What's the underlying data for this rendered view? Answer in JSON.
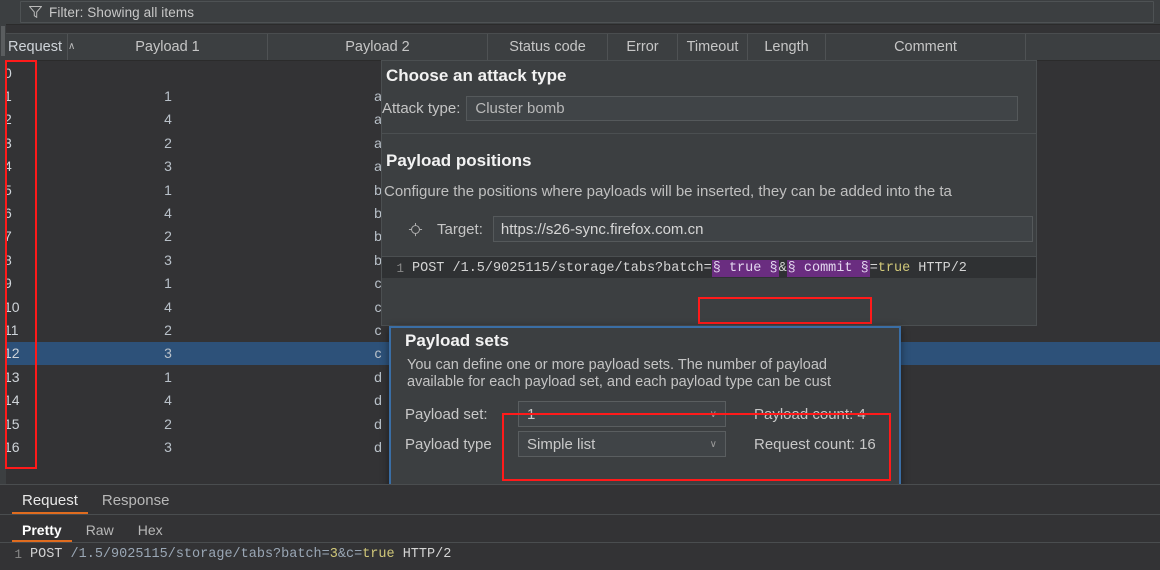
{
  "filter": {
    "icon": "funnel-icon",
    "text": "Filter: Showing all items"
  },
  "table": {
    "columns": [
      {
        "label": "Request",
        "sort": "∧"
      },
      {
        "label": "Payload 1"
      },
      {
        "label": "Payload 2"
      },
      {
        "label": "Status code"
      },
      {
        "label": "Error"
      },
      {
        "label": "Timeout"
      },
      {
        "label": "Length"
      },
      {
        "label": "Comment"
      }
    ],
    "rows": [
      {
        "request": "0",
        "p1": "",
        "p2": "",
        "status": "",
        "error": "",
        "timeout": "",
        "length": "",
        "comment": "",
        "selected": false
      },
      {
        "request": "1",
        "p1": "1",
        "p2": "a",
        "status": "",
        "error": "",
        "timeout": "",
        "length": "",
        "comment": "",
        "selected": false
      },
      {
        "request": "2",
        "p1": "4",
        "p2": "a",
        "status": "",
        "error": "",
        "timeout": "",
        "length": "",
        "comment": "",
        "selected": false
      },
      {
        "request": "3",
        "p1": "2",
        "p2": "a",
        "status": "",
        "error": "",
        "timeout": "",
        "length": "",
        "comment": "",
        "selected": false
      },
      {
        "request": "4",
        "p1": "3",
        "p2": "a",
        "status": "",
        "error": "",
        "timeout": "",
        "length": "",
        "comment": "",
        "selected": false
      },
      {
        "request": "5",
        "p1": "1",
        "p2": "b",
        "status": "",
        "error": "",
        "timeout": "",
        "length": "",
        "comment": "",
        "selected": false
      },
      {
        "request": "6",
        "p1": "4",
        "p2": "b",
        "status": "",
        "error": "",
        "timeout": "",
        "length": "",
        "comment": "",
        "selected": false
      },
      {
        "request": "7",
        "p1": "2",
        "p2": "b",
        "status": "",
        "error": "",
        "timeout": "",
        "length": "",
        "comment": "",
        "selected": false
      },
      {
        "request": "8",
        "p1": "3",
        "p2": "b",
        "status": "",
        "error": "",
        "timeout": "",
        "length": "",
        "comment": "",
        "selected": false
      },
      {
        "request": "9",
        "p1": "1",
        "p2": "c",
        "status": "",
        "error": "",
        "timeout": "",
        "length": "",
        "comment": "",
        "selected": false
      },
      {
        "request": "10",
        "p1": "4",
        "p2": "c",
        "status": "",
        "error": "",
        "timeout": "",
        "length": "",
        "comment": "",
        "selected": false
      },
      {
        "request": "11",
        "p1": "2",
        "p2": "c",
        "status": "",
        "error": "",
        "timeout": "",
        "length": "",
        "comment": "",
        "selected": false
      },
      {
        "request": "12",
        "p1": "3",
        "p2": "c",
        "status": "",
        "error": "",
        "timeout": "",
        "length": "",
        "comment": "",
        "selected": true
      },
      {
        "request": "13",
        "p1": "1",
        "p2": "d",
        "status": "",
        "error": "",
        "timeout": "",
        "length": "",
        "comment": "",
        "selected": false
      },
      {
        "request": "14",
        "p1": "4",
        "p2": "d",
        "status": "",
        "error": "",
        "timeout": "",
        "length": "",
        "comment": "",
        "selected": false
      },
      {
        "request": "15",
        "p1": "2",
        "p2": "d",
        "status": "",
        "error": "",
        "timeout": "",
        "length": "",
        "comment": "",
        "selected": false
      },
      {
        "request": "16",
        "p1": "3",
        "p2": "d",
        "status": "",
        "error": "",
        "timeout": "",
        "length": "",
        "comment": "",
        "selected": false
      }
    ]
  },
  "attack": {
    "title": "Choose an attack type",
    "type_label": "Attack type:",
    "type_value": "Cluster bomb"
  },
  "positions": {
    "title": "Payload positions",
    "description": "Configure the positions where payloads will be inserted, they can be added into the ta",
    "target_icon": "crosshair-icon",
    "target_label": "Target:",
    "target_value": "https://s26-sync.firefox.com.cn",
    "code": {
      "lineno": "1",
      "pre": "POST /1.5/9025115/storage/tabs?batch=",
      "marker1": "§ true §",
      "amp": "&",
      "marker2": "§ commit §",
      "eq": "=",
      "val": "true",
      "suffix": " HTTP/2"
    }
  },
  "payload_sets": {
    "title": "Payload sets",
    "description_line1": "You can define one or more payload sets. The number of payload",
    "description_line2": "available for each payload set, and each payload type can be cust",
    "set_label": "Payload set:",
    "set_value": "1",
    "type_label": "Payload type",
    "type_value": "Simple list",
    "payload_count": "Payload count: 4",
    "request_count": "Request count: 16",
    "chevron": "∨"
  },
  "bottom": {
    "tabs": [
      {
        "label": "Request",
        "active": true
      },
      {
        "label": "Response",
        "active": false
      }
    ],
    "view_tabs": [
      {
        "label": "Pretty",
        "active": true
      },
      {
        "label": "Raw",
        "active": false
      },
      {
        "label": "Hex",
        "active": false
      }
    ],
    "code": {
      "lineno": "1",
      "method": "POST ",
      "path": "/1.5/9025115/storage/tabs?batch=",
      "num": "3",
      "amp": "&c=",
      "bool": "true",
      "proto": " HTTP/2"
    }
  },
  "colors": {
    "accent": "#e06c1f",
    "selection": "#2d5179",
    "annotation": "#ff1a1a",
    "dialog_border": "#3a6ea5",
    "marker": "#6a2d80"
  }
}
